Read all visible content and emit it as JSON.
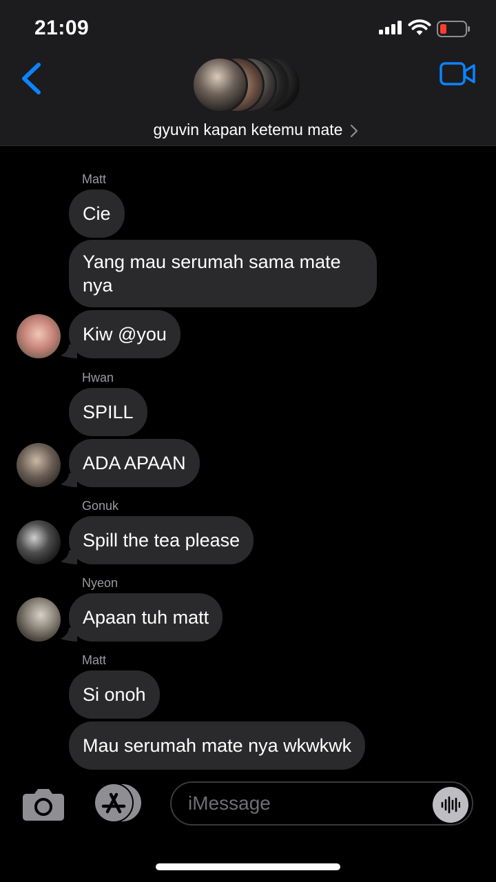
{
  "status": {
    "time": "21:09"
  },
  "header": {
    "title": "gyuvin kapan ketemu mate"
  },
  "messages": [
    {
      "sender": "Matt",
      "text": "Cie"
    },
    {
      "text": "Yang mau serumah sama mate nya"
    },
    {
      "text": "Kiw @you"
    },
    {
      "sender": "Hwan",
      "text": "SPILL"
    },
    {
      "text": "ADA APAAN"
    },
    {
      "sender": "Gonuk",
      "text": "Spill the tea please"
    },
    {
      "sender": "Nyeon",
      "text": "Apaan tuh matt"
    },
    {
      "sender": "Matt",
      "text": "Si onoh"
    },
    {
      "text": "Mau serumah mate nya wkwkwk"
    }
  ],
  "input": {
    "placeholder": "iMessage"
  },
  "colors": {
    "accent": "#0a84ff",
    "bubble": "#2a2a2c",
    "background": "#000000",
    "header": "#1c1c1e",
    "battery_low": "#ff3b30"
  },
  "icons": [
    "back-chevron-icon",
    "video-call-icon",
    "camera-icon",
    "app-store-icon",
    "audio-message-icon",
    "signal-icon",
    "wifi-icon",
    "battery-icon"
  ]
}
